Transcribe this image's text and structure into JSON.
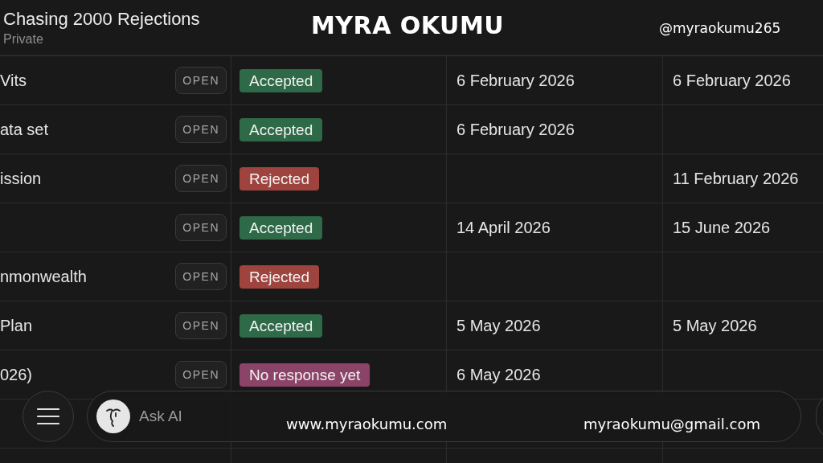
{
  "header": {
    "title": "Chasing 2000 Rejections",
    "subtitle": "Private"
  },
  "overlay": {
    "name": "MYRA OKUMU",
    "handle": "@myraokumu265",
    "website": "www.myraokumu.com",
    "email": "myraokumu@gmail.com"
  },
  "table": {
    "rows": [
      {
        "name": "Vits",
        "open": "OPEN",
        "status": {
          "label": "Accepted",
          "color": "#2e6a47"
        },
        "date_1": "6 February 2026",
        "date_2": "6 February 2026"
      },
      {
        "name": "ata set",
        "open": "OPEN",
        "status": {
          "label": "Accepted",
          "color": "#2e6a47"
        },
        "date_1": "6 February 2026"
      },
      {
        "name": "ission",
        "open": "OPEN",
        "status": {
          "label": "Rejected",
          "color": "#9e433d"
        },
        "date_2": "11 February 2026"
      },
      {
        "open": "OPEN",
        "status": {
          "label": "Accepted",
          "color": "#2e6a47"
        },
        "date_1": "14 April 2026",
        "date_2": "15 June 2026"
      },
      {
        "name": "nmonwealth",
        "open": "OPEN",
        "status": {
          "label": "Rejected",
          "color": "#9e433d"
        }
      },
      {
        "name": "Plan",
        "open": "OPEN",
        "status": {
          "label": "Accepted",
          "color": "#2e6a47"
        },
        "date_1": "5 May 2026",
        "date_2": "5 May 2026"
      },
      {
        "name": "026)",
        "open": "OPEN",
        "status": {
          "label": "No response yet",
          "color": "#8b4468"
        },
        "date_1": "6 May 2026"
      }
    ]
  },
  "bottom_bar": {
    "ask_ai": "Ask AI"
  }
}
